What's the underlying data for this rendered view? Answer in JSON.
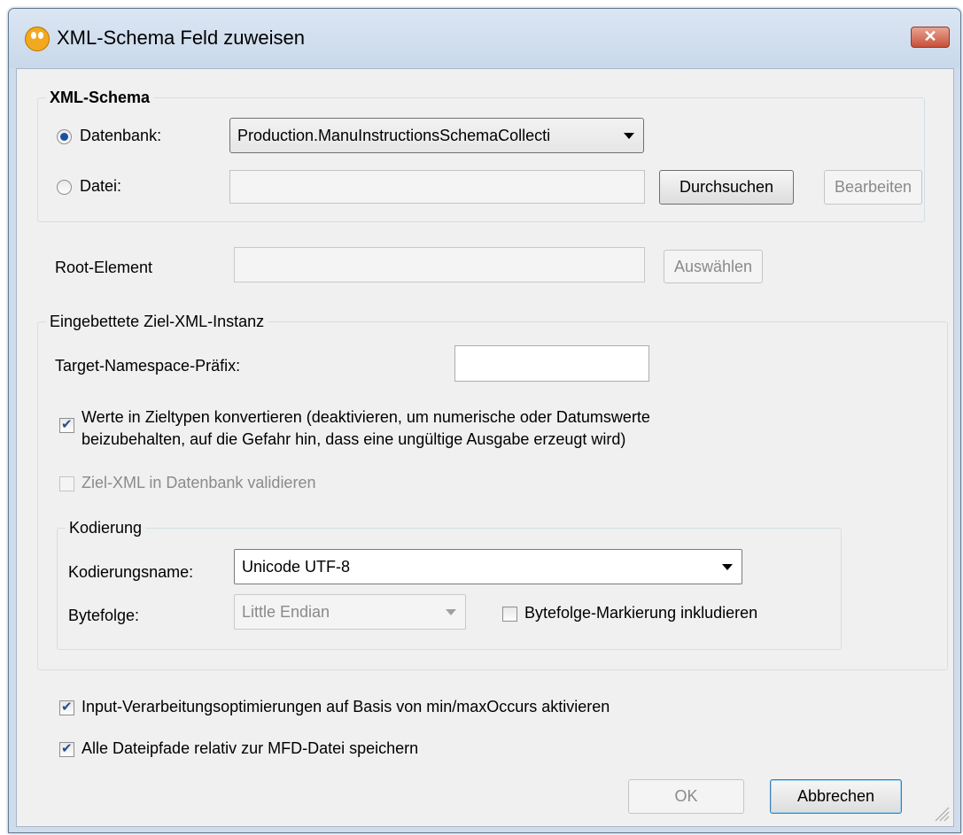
{
  "window": {
    "title": "XML-Schema Feld zuweisen"
  },
  "schema_group": {
    "legend": "XML-Schema",
    "database_label": "Datenbank:",
    "database_selected": true,
    "database_value": "Production.ManuInstructionsSchemaCollecti",
    "file_label": "Datei:",
    "file_value": "",
    "browse_label": "Durchsuchen",
    "edit_label": "Bearbeiten"
  },
  "root_element": {
    "label": "Root-Element",
    "value": "",
    "select_label": "Auswählen"
  },
  "embedded_group": {
    "legend": "Eingebettete Ziel-XML-Instanz",
    "namespace_label": "Target-Namespace-Präfix:",
    "namespace_value": "",
    "convert_label_line1": "Werte in Zieltypen konvertieren (deaktivieren, um numerische oder Datumswerte",
    "convert_label_line2": "beizubehalten, auf die Gefahr hin, dass eine ungültige Ausgabe erzeugt wird)",
    "convert_checked": true,
    "validate_label": "Ziel-XML in Datenbank validieren",
    "validate_checked": false
  },
  "encoding_group": {
    "legend": "Kodierung",
    "name_label": "Kodierungsname:",
    "name_value": "Unicode UTF-8",
    "byteorder_label": "Bytefolge:",
    "byteorder_value": "Little Endian",
    "bom_label": "Bytefolge-Markierung inkludieren",
    "bom_checked": false
  },
  "options": {
    "optimize_label": "Input-Verarbeitungsoptimierungen auf Basis von min/maxOccurs aktivieren",
    "optimize_checked": true,
    "relative_label": "Alle Dateipfade relativ zur MFD-Datei speichern",
    "relative_checked": true
  },
  "buttons": {
    "ok_label": "OK",
    "cancel_label": "Abbrechen"
  },
  "icons": {
    "app": "altova-app-icon",
    "close": "close-icon",
    "dropdown": "chevron-down-icon"
  }
}
